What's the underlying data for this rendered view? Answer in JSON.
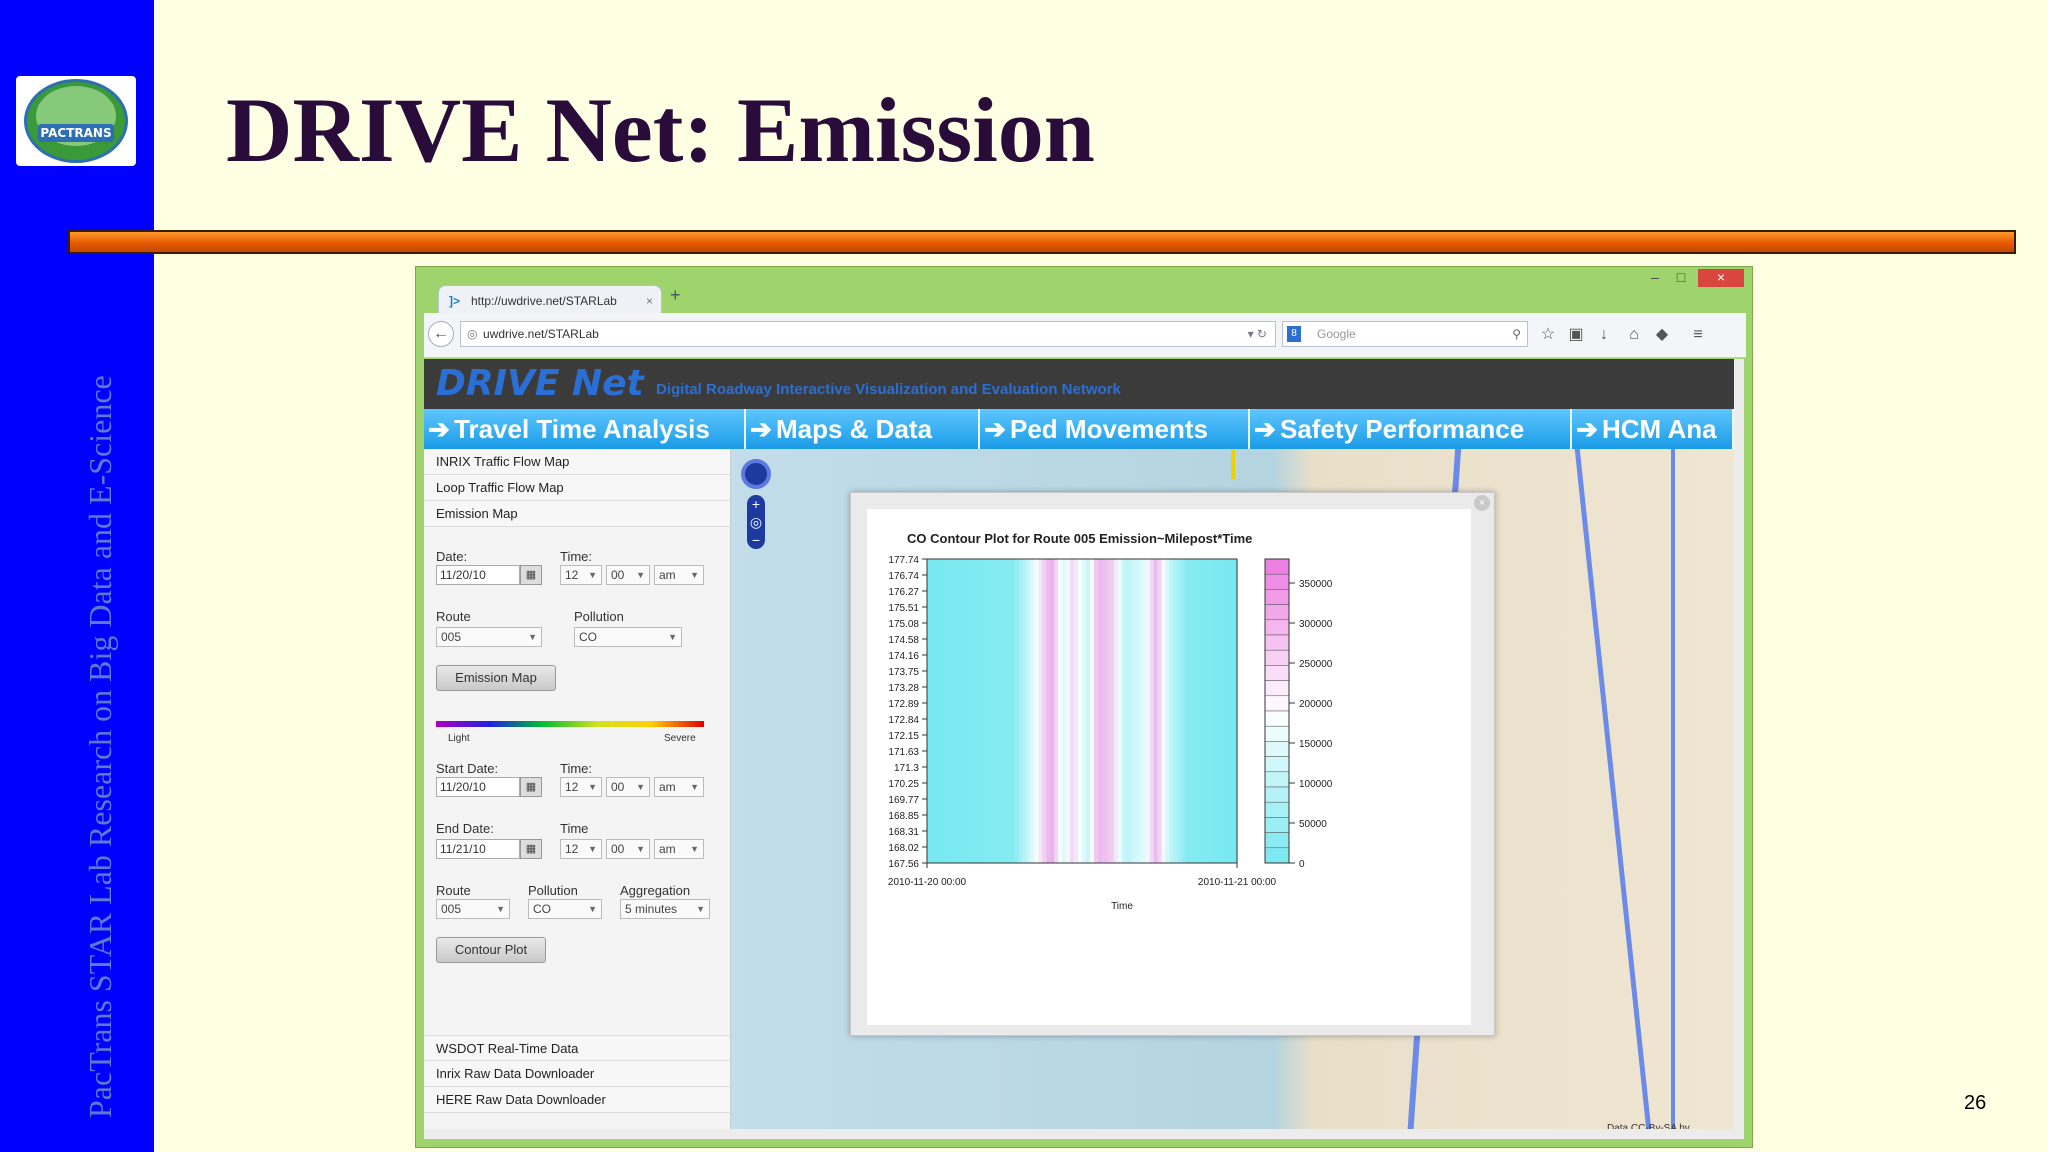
{
  "slide": {
    "title": "DRIVE Net: Emission",
    "side_text": "PacTrans STAR Lab Research on Big Data and E-Science",
    "page_number": "26",
    "logo_text": "PACTRANS",
    "accent_color": "#0000ff",
    "rule_color": "#e65a00"
  },
  "browser": {
    "tab_title": "http://uwdrive.net/STARLab",
    "tab_close": "×",
    "new_tab": "+",
    "url": "uwdrive.net/STARLab",
    "search_placeholder": "Google",
    "window_controls": {
      "minimize": "–",
      "maximize": "□",
      "close": "×"
    },
    "toolbar_icons": [
      "star-icon",
      "clipboard-icon",
      "download-icon",
      "home-icon",
      "shield-icon",
      "menu-icon"
    ]
  },
  "app": {
    "logo": "DRIVE Net",
    "subtitle": "Digital Roadway Interactive Visualization and Evaluation Network",
    "nav_tabs": [
      "Travel Time Analysis",
      "Maps & Data",
      "Ped Movements",
      "Safety Performance",
      "HCM Ana"
    ],
    "menu_items": [
      "INRIX Traffic Flow Map",
      "Loop Traffic Flow Map",
      "Emission Map"
    ],
    "form1": {
      "date_label": "Date:",
      "date_value": "11/20/10",
      "time_label": "Time:",
      "hour": "12",
      "minute": "00",
      "ampm": "am",
      "route_label": "Route",
      "route_value": "005",
      "pollution_label": "Pollution",
      "pollution_value": "CO",
      "button": "Emission Map"
    },
    "scale": {
      "light": "Light",
      "severe": "Severe"
    },
    "form2": {
      "start_label": "Start Date:",
      "start_value": "11/20/10",
      "time_label": "Time:",
      "start_hour": "12",
      "start_minute": "00",
      "start_ampm": "am",
      "end_label": "End Date:",
      "end_value": "11/21/10",
      "time_label2": "Time",
      "end_hour": "12",
      "end_minute": "00",
      "end_ampm": "am",
      "route_label": "Route",
      "route_value": "005",
      "pollution_label": "Pollution",
      "pollution_value": "CO",
      "aggregation_label": "Aggregation",
      "aggregation_value": "5 minutes",
      "button": "Contour Plot"
    },
    "bottom_links": [
      "WSDOT Real-Time Data",
      "Inrix Raw Data Downloader",
      "HERE Raw Data Downloader"
    ],
    "map_labels": {
      "copyright": "Data CC-By-SA by"
    }
  },
  "chart_data": {
    "type": "heatmap",
    "title": "CO Contour Plot for Route 005 Emission~Milepost*Time",
    "xlabel": "Time",
    "ylabel": "",
    "x_ticks": [
      "2010-11-20 00:00",
      "2010-11-21 00:00"
    ],
    "y_ticks": [
      "177.74",
      "176.74",
      "176.27",
      "175.51",
      "175.08",
      "174.58",
      "174.16",
      "173.75",
      "173.28",
      "172.89",
      "172.84",
      "172.15",
      "171.63",
      "171.3",
      "170.25",
      "169.77",
      "168.85",
      "168.31",
      "168.02",
      "167.56"
    ],
    "colorbar_ticks": [
      0,
      50000,
      100000,
      150000,
      200000,
      250000,
      300000,
      350000
    ],
    "colorbar_range": [
      0,
      380000
    ],
    "x_range": [
      0,
      1
    ],
    "time_profile": [
      {
        "t": 0.0,
        "v": 0
      },
      {
        "t": 0.28,
        "v": 20000
      },
      {
        "t": 0.34,
        "v": 150000
      },
      {
        "t": 0.4,
        "v": 320000
      },
      {
        "t": 0.44,
        "v": 150000
      },
      {
        "t": 0.47,
        "v": 250000
      },
      {
        "t": 0.52,
        "v": 120000
      },
      {
        "t": 0.55,
        "v": 300000
      },
      {
        "t": 0.6,
        "v": 260000
      },
      {
        "t": 0.64,
        "v": 100000
      },
      {
        "t": 0.7,
        "v": 160000
      },
      {
        "t": 0.74,
        "v": 300000
      },
      {
        "t": 0.78,
        "v": 120000
      },
      {
        "t": 0.84,
        "v": 20000
      },
      {
        "t": 1.0,
        "v": 0
      }
    ]
  }
}
